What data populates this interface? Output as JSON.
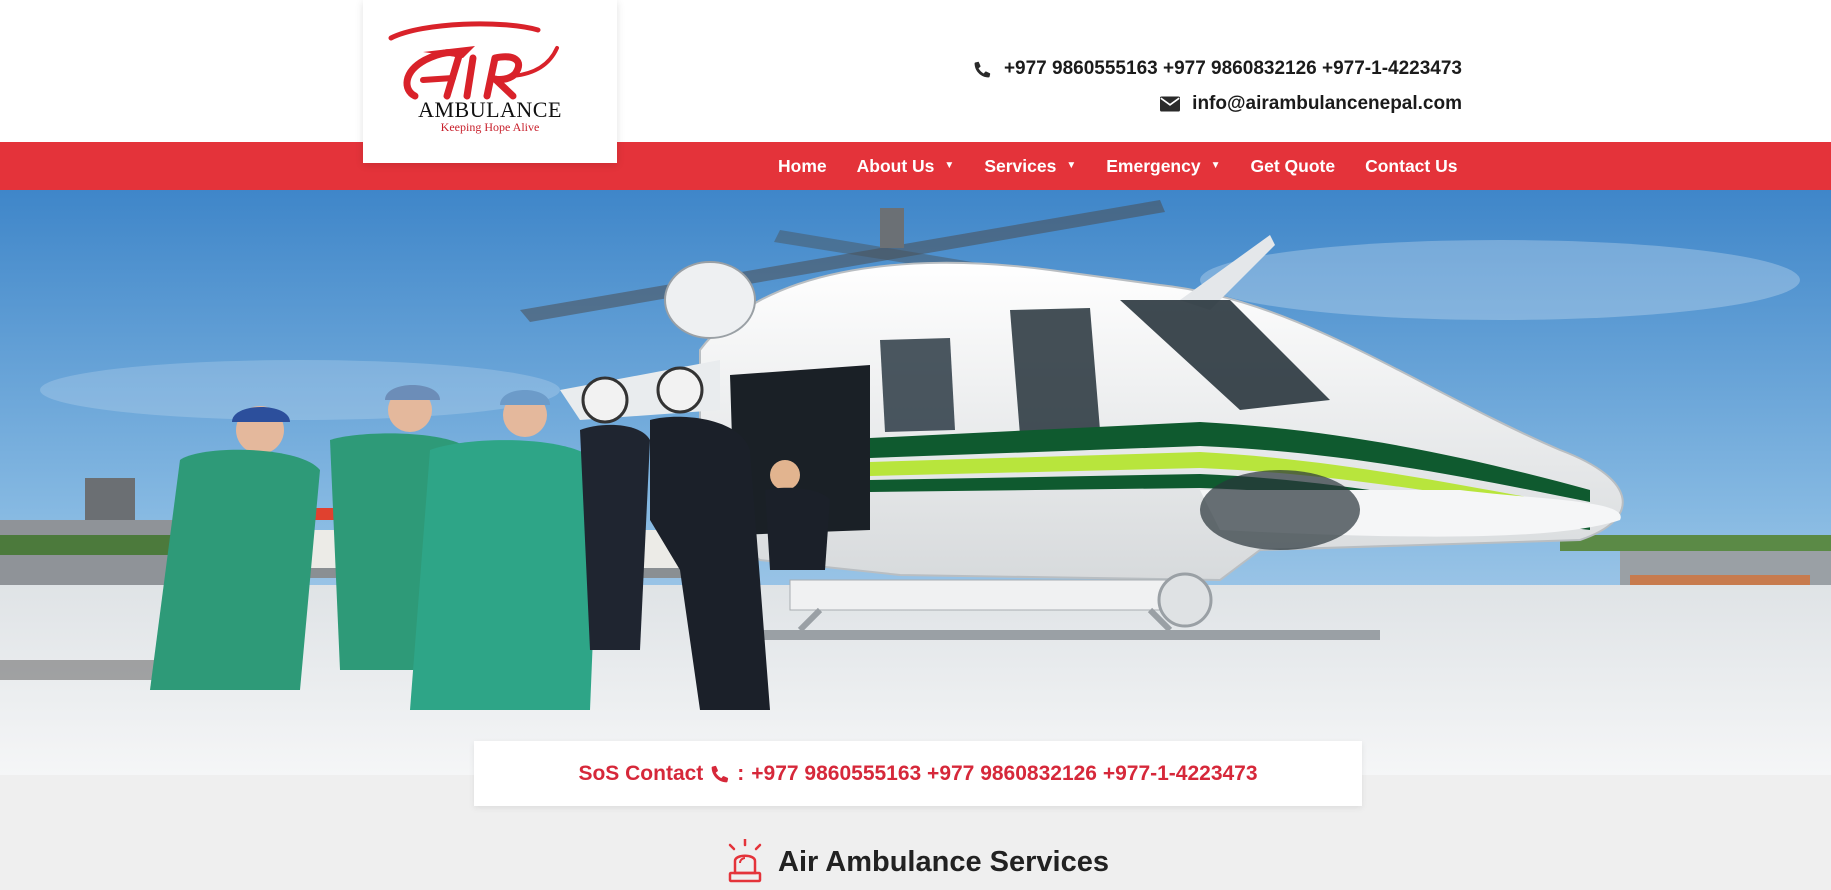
{
  "brand": {
    "logo_word": "AIR",
    "name": "AMBULANCE",
    "tagline": "Keeping Hope Alive",
    "accent_color": "#e4333a"
  },
  "header": {
    "phones": "+977 9860555163 +977 9860832126 +977-1-4223473",
    "phone_icon": "phone-icon",
    "email": "info@airambulancenepal.com",
    "email_icon": "envelope-icon"
  },
  "nav": {
    "items": [
      {
        "label": "Home",
        "dropdown": false
      },
      {
        "label": "About Us",
        "dropdown": true
      },
      {
        "label": "Services",
        "dropdown": true
      },
      {
        "label": "Emergency",
        "dropdown": true
      },
      {
        "label": "Get Quote",
        "dropdown": false
      },
      {
        "label": "Contact Us",
        "dropdown": false
      }
    ],
    "caret_glyph": "▼"
  },
  "hero": {
    "image_description": "Medical team in green scrubs loading a patient on a stretcher into a white and green rescue helicopter on a rooftop helipad under a blue sky"
  },
  "sos": {
    "label": "SoS Contact",
    "separator": ":",
    "phones": "+977 9860555163 +977 9860832126 +977-1-4223473",
    "icon": "phone-icon"
  },
  "services": {
    "title": "Air Ambulance Services",
    "icon": "siren-icon"
  }
}
